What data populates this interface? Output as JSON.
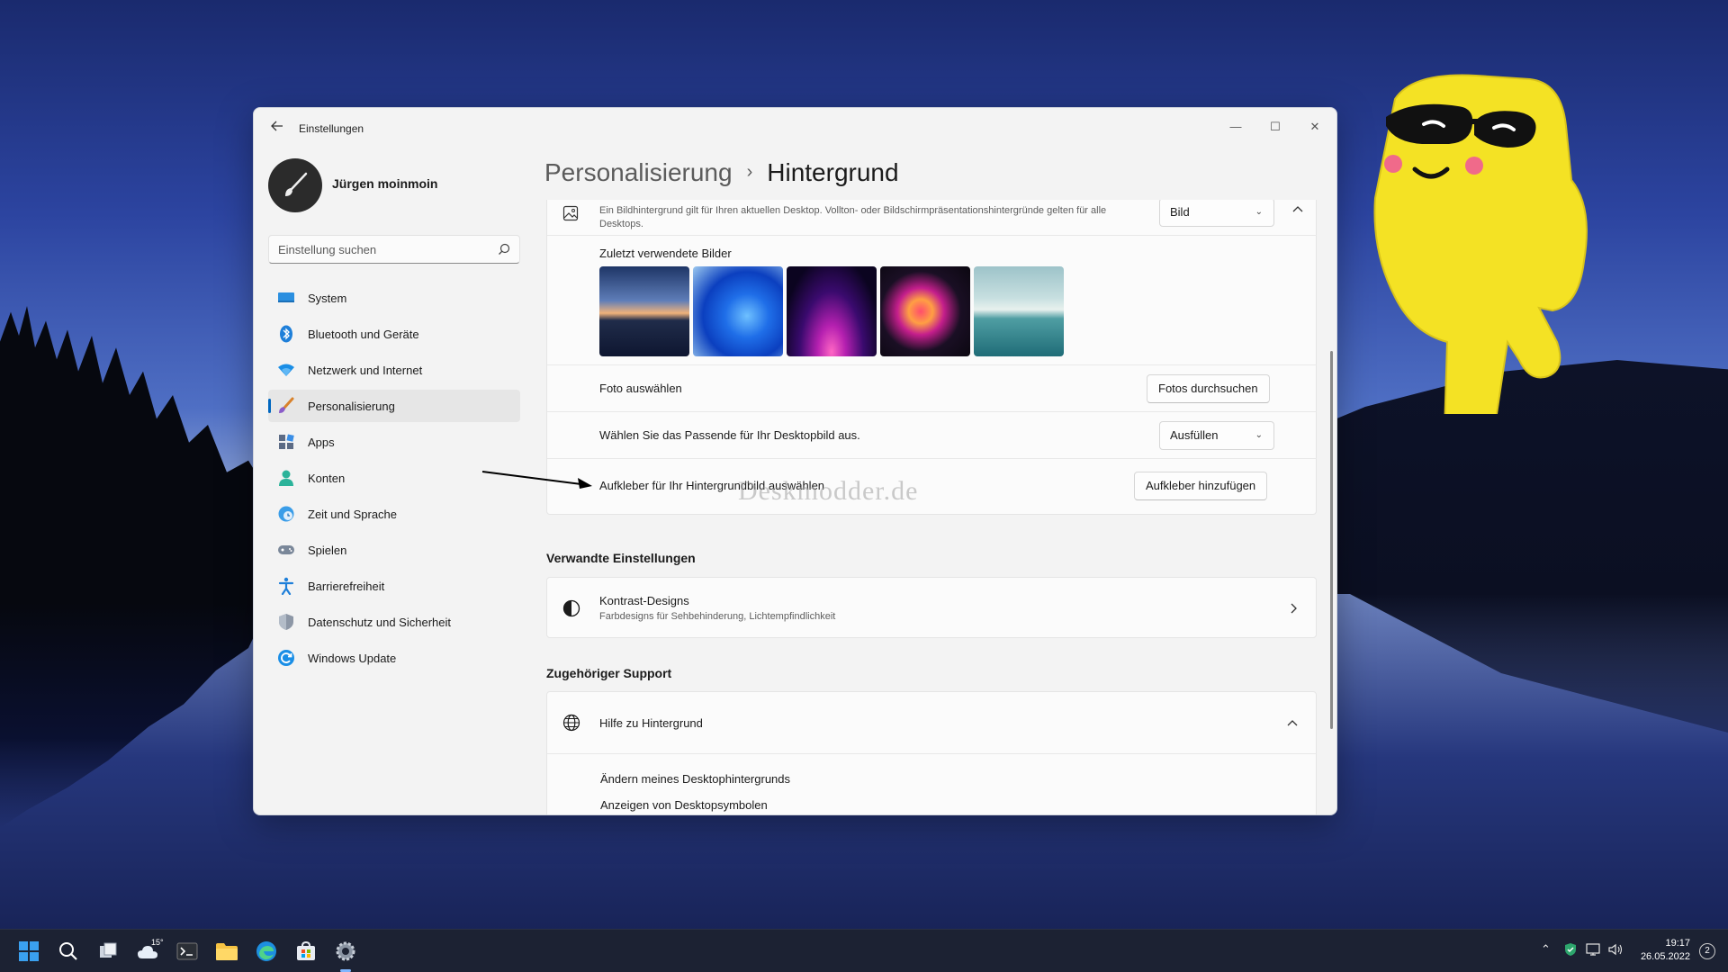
{
  "window": {
    "app_title": "Einstellungen",
    "back_icon": "arrow-left-icon",
    "minimize": "—",
    "maximize": "☐",
    "close": "✕"
  },
  "user": {
    "name": "Jürgen moinmoin"
  },
  "search": {
    "placeholder": "Einstellung suchen"
  },
  "sidebar": {
    "items": [
      {
        "label": "System",
        "icon": "monitor-icon"
      },
      {
        "label": "Bluetooth und Geräte",
        "icon": "bluetooth-icon"
      },
      {
        "label": "Netzwerk und Internet",
        "icon": "wifi-icon"
      },
      {
        "label": "Personalisierung",
        "icon": "brush-icon",
        "active": true
      },
      {
        "label": "Apps",
        "icon": "apps-icon"
      },
      {
        "label": "Konten",
        "icon": "person-icon"
      },
      {
        "label": "Zeit und Sprache",
        "icon": "clock-globe-icon"
      },
      {
        "label": "Spielen",
        "icon": "gamepad-icon"
      },
      {
        "label": "Barrierefreiheit",
        "icon": "accessibility-icon"
      },
      {
        "label": "Datenschutz und Sicherheit",
        "icon": "shield-icon"
      },
      {
        "label": "Windows Update",
        "icon": "refresh-icon"
      }
    ]
  },
  "breadcrumb": {
    "parent": "Personalisierung",
    "separator": "›",
    "current": "Hintergrund"
  },
  "background": {
    "description": "Ein Bildhintergrund gilt für Ihren aktuellen Desktop. Vollton- oder Bildschirmpräsentationshintergründe gelten für alle Desktops.",
    "type_value": "Bild",
    "recent_title": "Zuletzt verwendete Bilder",
    "photo_label": "Foto auswählen",
    "photo_button": "Fotos durchsuchen",
    "fit_label": "Wählen Sie das Passende für Ihr Desktopbild aus.",
    "fit_value": "Ausfüllen",
    "sticker_label": "Aufkleber für Ihr Hintergrundbild auswählen",
    "sticker_button": "Aufkleber hinzufügen"
  },
  "related": {
    "title": "Verwandte Einstellungen",
    "contrast_title": "Kontrast-Designs",
    "contrast_desc": "Farbdesigns für Sehbehinderung, Lichtempfindlichkeit"
  },
  "support": {
    "title": "Zugehöriger Support",
    "help_title": "Hilfe zu Hintergrund",
    "links": [
      "Ändern meines Desktophintergrunds",
      "Anzeigen von Desktopsymbolen"
    ]
  },
  "watermark": "Deskmodder.de",
  "taskbar": {
    "weather_temp": "15°",
    "time": "19:17",
    "date": "26.05.2022",
    "notifications": "2"
  },
  "colors": {
    "accent": "#0067c0",
    "taskbar": "#1c2233"
  }
}
